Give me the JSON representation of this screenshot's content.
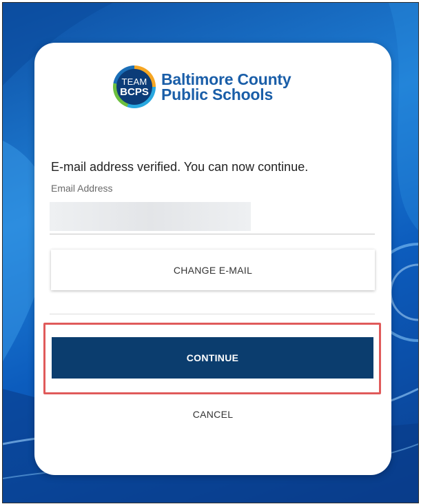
{
  "logo": {
    "badge_top": "TEAM",
    "badge_bottom": "BCPS",
    "line1": "Baltimore County",
    "line2": "Public Schools"
  },
  "form": {
    "verified_message": "E-mail address verified. You can now continue.",
    "email_label": "Email Address",
    "email_value": "",
    "change_email_label": "CHANGE E-MAIL",
    "continue_label": "CONTINUE",
    "cancel_label": "CANCEL"
  },
  "colors": {
    "primary_button": "#0b3d6e",
    "highlight_border": "#e05a5a",
    "logo_text": "#1a5ea8",
    "background_blue": "#1f7fd6"
  }
}
